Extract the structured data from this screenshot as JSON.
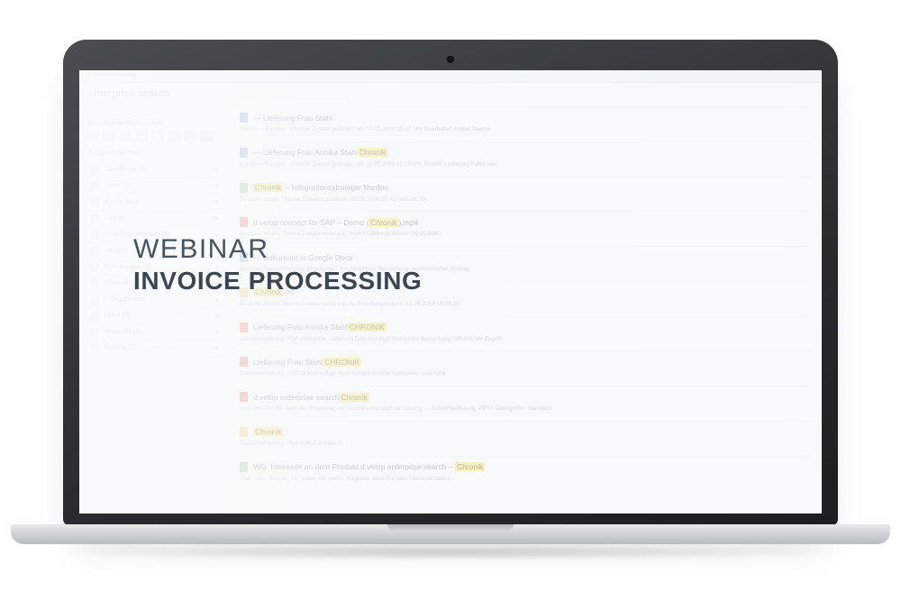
{
  "overlay": {
    "line1": "WEBINAR",
    "line2": "INVOICE PROCESSING"
  },
  "app": {
    "brand": "enterprise search",
    "topbar_crumb": "Unternehmenssuche",
    "section_providers": "Ausgewählte Suchprovider",
    "section_filters": "Ausgewählte Filter",
    "filters": [
      {
        "label": "Dateiformat (1)"
      },
      {
        "label": "Autor (1)"
      },
      {
        "label": "Bearbeitung"
      },
      {
        "label": "Kunde"
      },
      {
        "label": "Erstellungszeitraum (1)"
      },
      {
        "label": "Anlagen (1)"
      },
      {
        "label": "Dateianzeige (2)"
      },
      {
        "label": "Absender (1)"
      },
      {
        "label": "Erfolgspriorität"
      },
      {
        "label": "Label (1)"
      },
      {
        "label": "Absender (1)"
      },
      {
        "label": "Anhang (1)"
      }
    ],
    "results": [
      {
        "ico": "b",
        "title_pre": "— Lieferung Frau Stahl",
        "hl": "",
        "sub": "Kunden › Kunde1 · Chronik   Zuletzt geändert am 07.05.2000 15:17 Uhr   Bearbeiter: Andre Thieme"
      },
      {
        "ico": "b",
        "title_pre": "— Lieferung Frau Annika Stahl",
        "hl": "Chronik",
        "sub": "Kunden › Kunde1 · Chronik   Zuletzt geändert am 11.05.2000 12:14 Uhr   Betreff: Lieferung Paket neu"
      },
      {
        "ico": "g",
        "title_pre": "",
        "hl": "Chronik",
        "title_post": " – Integrationsstrategie Norden",
        "sub": "Besitzer: Andre Thieme   Erstellungsdatum: 03.06.2000 20:42   Version: 04"
      },
      {
        "ico": "r",
        "title_pre": "d.velop connect for SAP – Demo (",
        "hl": "Chronik",
        "title_post": ").mp4",
        "sub": "Besitzer: Andre Thieme   Dateierweiterung: mp4   Erstellungsdatum: 09.05.2000"
      },
      {
        "ico": "b",
        "title_pre": "— Dokument in Google Docs",
        "hl": "",
        "sub": "Besitzer: SharePoint-App   Empfänger: Thorben Meier   Bemerkung: automatischer Eintrag"
      },
      {
        "ico": "y",
        "title_pre": "",
        "hl": "Chronik",
        "title_post": ".txt",
        "sub": "Besitzer: Andre Thieme   Dateierweiterung: txt   Erstellungsdatum: 12.06.2019 16:06:25"
      },
      {
        "ico": "r",
        "title_pre": "Lieferung Frau Annika Stahl",
        "hl": "CHRONIK",
        "sub": "Dateierweiterung: PDF   Kategorie: Lieferung   Dokumenttyp: Dokument   Bemerkung: öffentlicher Zugriff"
      },
      {
        "ico": "r",
        "title_pre": "Lieferung Frau Stahl",
        "hl": "CHRONIK",
        "sub": "Dateierweiterung: PDF   Dokumenttyp: Rechnungskorrektur   Kategorie: Lieferung"
      },
      {
        "ico": "r",
        "title_pre": "d.velop enterprise search",
        "hl": "Chronik",
        "sub": "Live-Die Chronik dient der Erstellung von Notizen und wird zur Lösung …   Dateierweiterung: PPTX   Dateigröße: Standard"
      },
      {
        "ico": "y",
        "title_pre": "",
        "hl": "Chronik",
        "title_post": "",
        "sub": "Dateierweiterung: mp4   Aufruf-Anzahl: 0"
      },
      {
        "ico": "g",
        "title_pre": "WG: Interesse an dem Produkt d.velop enterprise search – ",
        "hl": "Chronik",
        "sub": "Hallo Herr Thieme, Sie hatten mir vorhin mitgeteilt, dass Sie kein Interesse haben …"
      }
    ]
  }
}
